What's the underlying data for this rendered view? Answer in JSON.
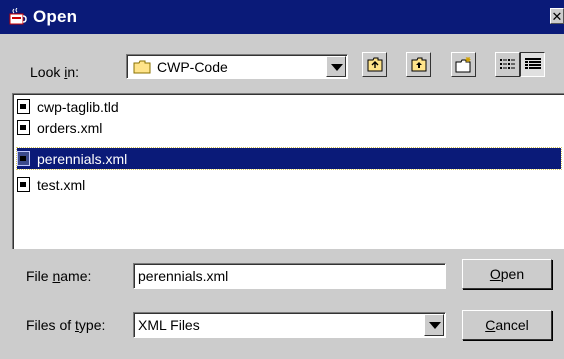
{
  "window": {
    "title": "Open",
    "close_glyph": "✕"
  },
  "lookin": {
    "label_pre": "Look ",
    "label_mnemonic": "i",
    "label_post": "n:",
    "value": "CWP-Code",
    "folder_icon": "folder-icon"
  },
  "toolbar": {
    "up_icon": "up-folder-icon",
    "home_icon": "home-icon",
    "new_folder_icon": "new-folder-icon",
    "list_view_icon": "list-view-icon",
    "details_view_icon": "details-view-icon"
  },
  "files": [
    {
      "name": "cwp-taglib.tld",
      "selected": false
    },
    {
      "name": "orders.xml",
      "selected": false
    },
    {
      "name": "perennials.xml",
      "selected": true
    },
    {
      "name": "test.xml",
      "selected": false
    }
  ],
  "filename": {
    "label_pre": "File ",
    "label_mnemonic": "n",
    "label_post": "ame:",
    "value": "perennials.xml"
  },
  "filetype": {
    "label_pre": "Files of ",
    "label_mnemonic": "t",
    "label_post": "ype:",
    "value": "XML Files"
  },
  "buttons": {
    "open_mnemonic": "O",
    "open_rest": "pen",
    "cancel_mnemonic": "C",
    "cancel_rest": "ancel"
  },
  "colors": {
    "titlebar": "#0a1a78",
    "selection": "#0a1a78",
    "dialog_bg": "#cccccc"
  }
}
